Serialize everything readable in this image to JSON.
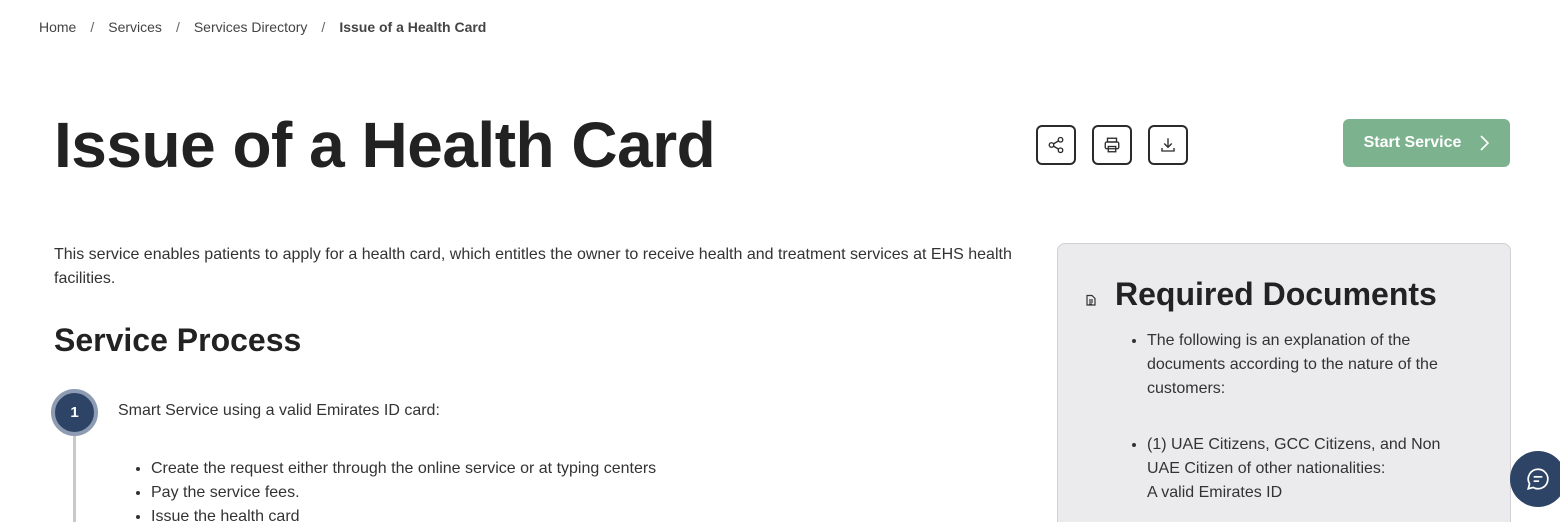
{
  "breadcrumb": {
    "items": [
      "Home",
      "Services",
      "Services Directory"
    ],
    "current": "Issue of a Health Card",
    "separator": "/"
  },
  "header": {
    "title": "Issue of a Health Card",
    "start_service_label": "Start Service"
  },
  "intro": {
    "text": "This service enables patients to apply for a health card, which entitles the owner to receive health and treatment services at EHS health facilities."
  },
  "process": {
    "title": "Service Process",
    "steps": [
      {
        "number": "1",
        "text": "Smart Service using a valid Emirates ID card:",
        "items": [
          "Create the request either through the online service or at typing centers",
          "Pay the service fees.",
          "Issue the health card"
        ]
      }
    ]
  },
  "documents": {
    "title": "Required Documents",
    "items": [
      "The following is an explanation of the documents according to the nature of the customers:",
      "(1) UAE Citizens, GCC Citizens, and Non UAE Citizen of other nationalities:",
      "A valid Emirates ID"
    ]
  },
  "icons": {
    "share": "share-icon",
    "print": "printer-icon",
    "download": "download-icon",
    "chevron": "chevron-right-icon",
    "document": "document-icon",
    "chat": "chat-icon"
  },
  "colors": {
    "accent": "#7db28f",
    "step": "#2d4466",
    "card_bg": "#ebebee"
  }
}
